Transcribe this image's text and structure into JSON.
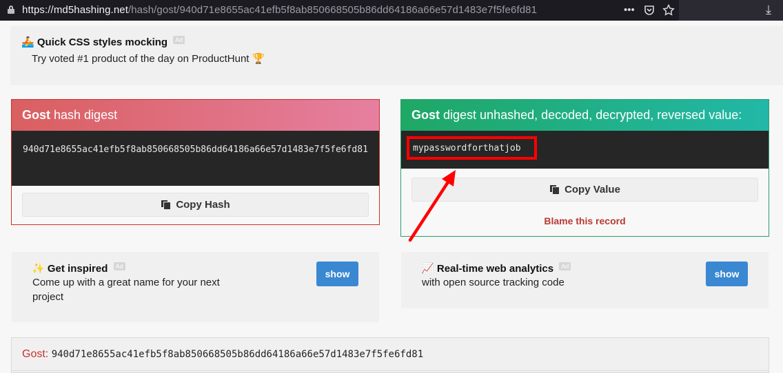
{
  "browser": {
    "url_host": "https://md5hashing.net",
    "url_path": "/hash/gost/940d71e8655ac41efb5f8ab850668505b86dd64186a66e57d1483e7f5fe6fd81",
    "more_label": "•••",
    "download_label": "⤓"
  },
  "ad_banner": {
    "emoji": "🚣",
    "title": "Quick CSS styles mocking",
    "badge": "Ad",
    "subtitle": "Try voted #1 product of the day on ProductHunt",
    "trophy": "🏆"
  },
  "hash_panel": {
    "algo": "Gost",
    "title_rest": " hash digest",
    "value": "940d71e8655ac41efb5f8ab850668505b86dd64186a66e57d1483e7f5fe6fd81",
    "copy_label": "Copy Hash"
  },
  "result_panel": {
    "algo": "Gost",
    "title_rest": " digest unhashed, decoded, decrypted, reversed value:",
    "value": "mypasswordforthatjob",
    "copy_label": "Copy Value",
    "blame_label": "Blame this record"
  },
  "ad_card_left": {
    "emoji": "✨",
    "title": "Get inspired",
    "badge": "Ad",
    "text": "Come up with a great name for your next project",
    "button": "show"
  },
  "ad_card_right": {
    "emoji": "📈",
    "title": "Real-time web analytics",
    "badge": "Ad",
    "text": "with open source tracking code",
    "button": "show"
  },
  "bottom": {
    "label": "Gost:",
    "value": "940d71e8655ac41efb5f8ab850668505b86dd64186a66e57d1483e7f5fe6fd81"
  },
  "colors": {
    "danger": "#c9302c",
    "success": "#2a9d6a",
    "primary": "#3a87d2",
    "highlight": "#ff0000"
  }
}
